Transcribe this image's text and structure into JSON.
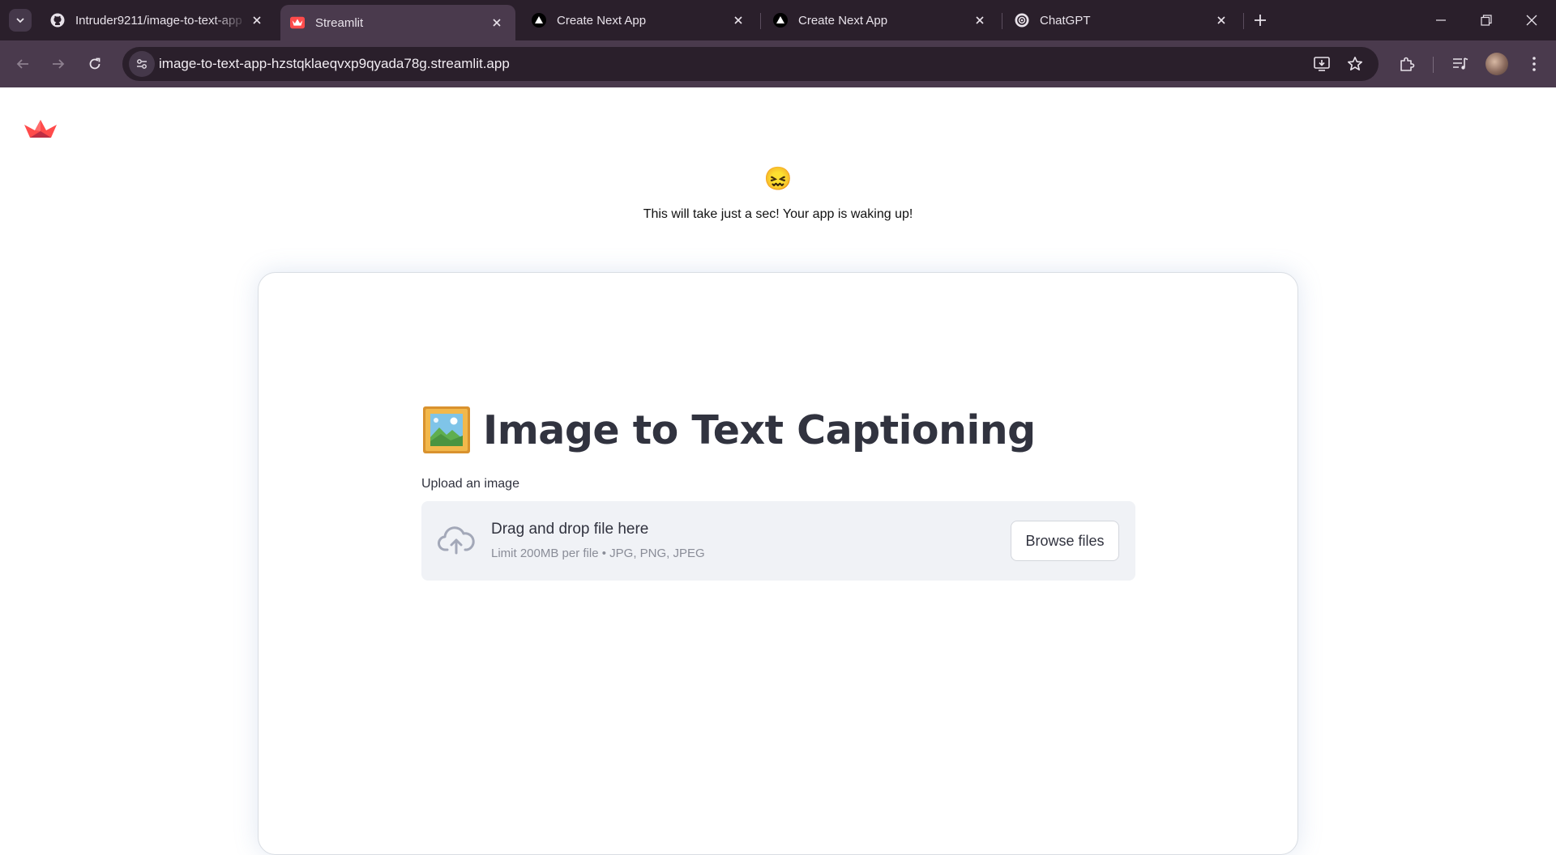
{
  "browser": {
    "tabs": [
      {
        "title": "Intruder9211/image-to-text-app",
        "favicon": "github-icon",
        "active": false
      },
      {
        "title": "Streamlit",
        "favicon": "streamlit-icon",
        "active": true
      },
      {
        "title": "Create Next App",
        "favicon": "nextjs-triangle-icon",
        "active": false
      },
      {
        "title": "Create Next App",
        "favicon": "nextjs-triangle-icon",
        "active": false
      },
      {
        "title": "ChatGPT",
        "favicon": "chatgpt-icon",
        "active": false
      }
    ],
    "url": "image-to-text-app-hzstqklaeqvxp9qyada78g.streamlit.app"
  },
  "page": {
    "wake_emoji": "😖",
    "wake_text": "This will take just a sec! Your app is waking up!",
    "app": {
      "title_emoji": "frame-with-picture-icon",
      "title": "Image to Text Captioning",
      "upload_label": "Upload an image",
      "dropzone_text": "Drag and drop file here",
      "dropzone_limit": "Limit 200MB per file • JPG, PNG, JPEG",
      "browse_button": "Browse files"
    }
  },
  "colors": {
    "chrome_dark": "#2a1f2b",
    "chrome_toolbar": "#4a3a4d",
    "streamlit_red": "#ff4b4b",
    "text_primary": "#31333f",
    "dropzone_bg": "#f0f2f6"
  }
}
